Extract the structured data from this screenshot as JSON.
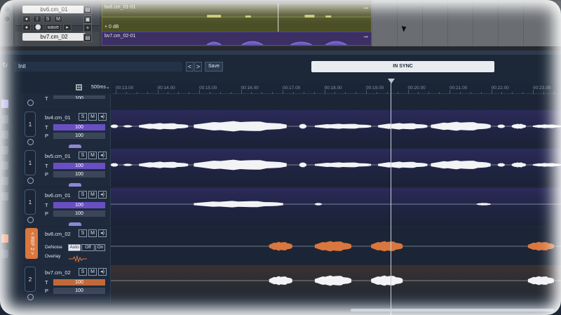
{
  "daw": {
    "tracks": [
      {
        "name": "bv6.cm_01",
        "buttons": [
          "S",
          "M",
          "R",
          "I",
          "W"
        ],
        "mode": "wave"
      },
      {
        "name": "bv7.cm_02",
        "buttons": [
          "",
          "",
          "",
          "",
          ""
        ],
        "mode": ""
      }
    ],
    "clips": [
      {
        "name": "bv6.cm_01-01",
        "gain": "+ 0 dB"
      },
      {
        "name": "bv7.cm_02-01",
        "gain": ""
      }
    ],
    "colors": {
      "clip1": "#4b4f25",
      "clip2": "#3b2f63"
    }
  },
  "toolbar": {
    "preset_name": "Init",
    "prev_label": "<",
    "next_label": ">",
    "save_label": "Save",
    "sync_label": "IN SYNC"
  },
  "ruler": {
    "zoom": "500ms",
    "ticks": [
      "00:13.00",
      "00:14.00",
      "00:15.00",
      "00:16.00",
      "00:17.00",
      "00:18.00",
      "00:19.00",
      "00:20.00",
      "00:21.00",
      "00:22.00",
      "00:23.00"
    ]
  },
  "tracks": [
    {
      "name": "bv4.cm_01",
      "number": "1",
      "solo": "S",
      "mute": "M",
      "t_label": "T",
      "t_value": "100",
      "p_label": "P",
      "p_value": "100",
      "color": "#6a4fc4"
    },
    {
      "name": "bv5.cm_01",
      "number": "1",
      "solo": "S",
      "mute": "M",
      "t_label": "T",
      "t_value": "100",
      "p_label": "P",
      "p_value": "100",
      "color": "#6a4fc4"
    },
    {
      "name": "bv6.cm_01",
      "number": "1",
      "solo": "S",
      "mute": "M",
      "t_label": "T",
      "t_value": "100",
      "p_label": "P",
      "p_value": "100",
      "color": "#6a4fc4"
    },
    {
      "name": "bv8.cm_02",
      "ref_label": "< REF 2 >",
      "solo": "S",
      "mute": "M",
      "denoise_label": "DeNoise",
      "denoise_options": [
        "Auto",
        "Off",
        "On"
      ],
      "denoise_selected": "Auto",
      "overlay_label": "Overlay",
      "color": "#d9773f"
    },
    {
      "name": "bv7.cm_02",
      "number": "2",
      "solo": "S",
      "mute": "M",
      "t_label": "T",
      "t_value": "100",
      "p_label": "P",
      "p_value": "100",
      "color": "#c06a3a"
    }
  ],
  "partial_top": {
    "t_value": "100"
  }
}
